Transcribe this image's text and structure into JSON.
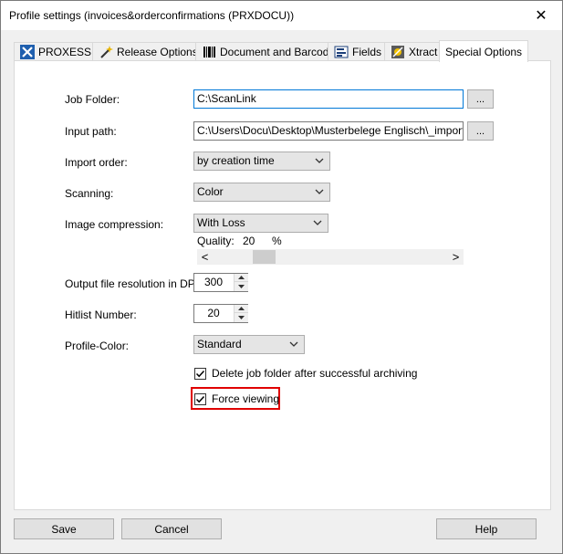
{
  "window": {
    "title": "Profile settings (invoices&orderconfirmations (PRXDOCU))",
    "close_glyph": "✕"
  },
  "tabs": [
    {
      "label": "PROXESS",
      "icon": "proxess-logo-icon"
    },
    {
      "label": "Release Options",
      "icon": "magic-wand-icon"
    },
    {
      "label": "Document and Barcode",
      "icon": "barcode-icon"
    },
    {
      "label": "Fields",
      "icon": "fields-icon"
    },
    {
      "label": "Xtract",
      "icon": "xtract-icon"
    },
    {
      "label": "Special Options",
      "active": true
    }
  ],
  "form": {
    "job_folder": {
      "label": "Job Folder:",
      "value": "C:\\ScanLink",
      "browse": "..."
    },
    "input_path": {
      "label": "Input path:",
      "value": "C:\\Users\\Docu\\Desktop\\Musterbelege Englisch\\_import sca",
      "browse": "..."
    },
    "import_order": {
      "label": "Import order:",
      "value": "by creation time"
    },
    "scanning": {
      "label": "Scanning:",
      "value": "Color"
    },
    "image_compression": {
      "label": "Image compression:",
      "value": "With Loss"
    },
    "quality": {
      "label": "Quality:",
      "value": "20",
      "unit": "%"
    },
    "quality_scroll": {
      "left_arrow": "<",
      "right_arrow": ">"
    },
    "resolution": {
      "label": "Output file resolution in DPI:",
      "value": "300"
    },
    "hitlist_number": {
      "label": "Hitlist Number:",
      "value": "20"
    },
    "profile_color": {
      "label": "Profile-Color:",
      "value": "Standard"
    },
    "delete_job_folder": {
      "label": "Delete job folder after successful archiving",
      "checked": true
    },
    "force_viewing": {
      "label": "Force viewing",
      "checked": true
    }
  },
  "buttons": {
    "save": "Save",
    "cancel": "Cancel",
    "help": "Help"
  },
  "colors": {
    "highlight": "#e00000",
    "focus": "#0078d7"
  }
}
